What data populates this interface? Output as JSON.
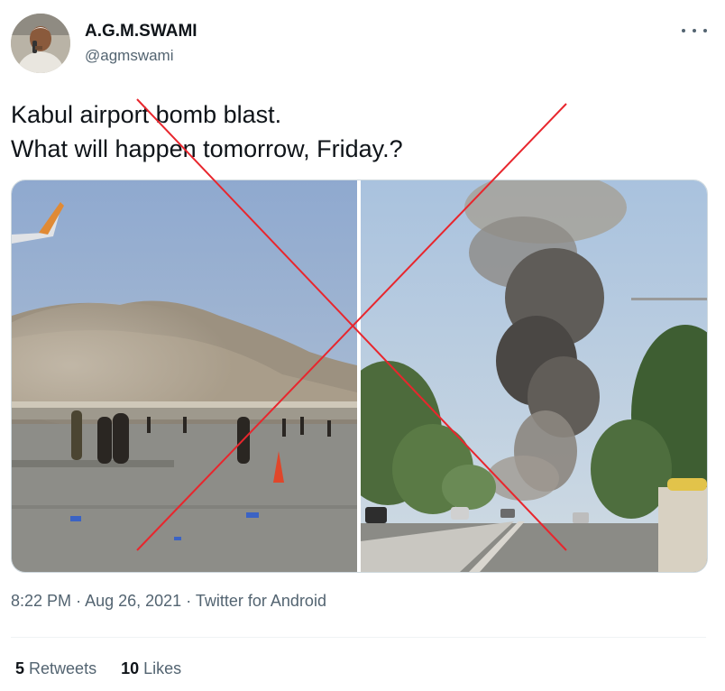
{
  "author": {
    "name": "A.G.M.SWAMI",
    "handle": "@agmswami"
  },
  "tweet": {
    "lines": [
      "Kabul airport bomb blast.",
      "What will happen tomorrow, Friday.?"
    ]
  },
  "media": {
    "left_image": "airport-dust-cloud-photo",
    "right_image": "street-smoke-plume-photo",
    "overlay": "red-x-cross"
  },
  "meta": {
    "time": "8:22 PM",
    "date": "Aug 26, 2021",
    "separator": "·",
    "source": "Twitter for Android"
  },
  "stats": {
    "retweets_count": "5",
    "retweets_label": "Retweets",
    "likes_count": "10",
    "likes_label": "Likes"
  },
  "colors": {
    "text": "#0f1419",
    "secondary": "#536471",
    "cross": "#e8262d",
    "border": "#cfd9de"
  }
}
